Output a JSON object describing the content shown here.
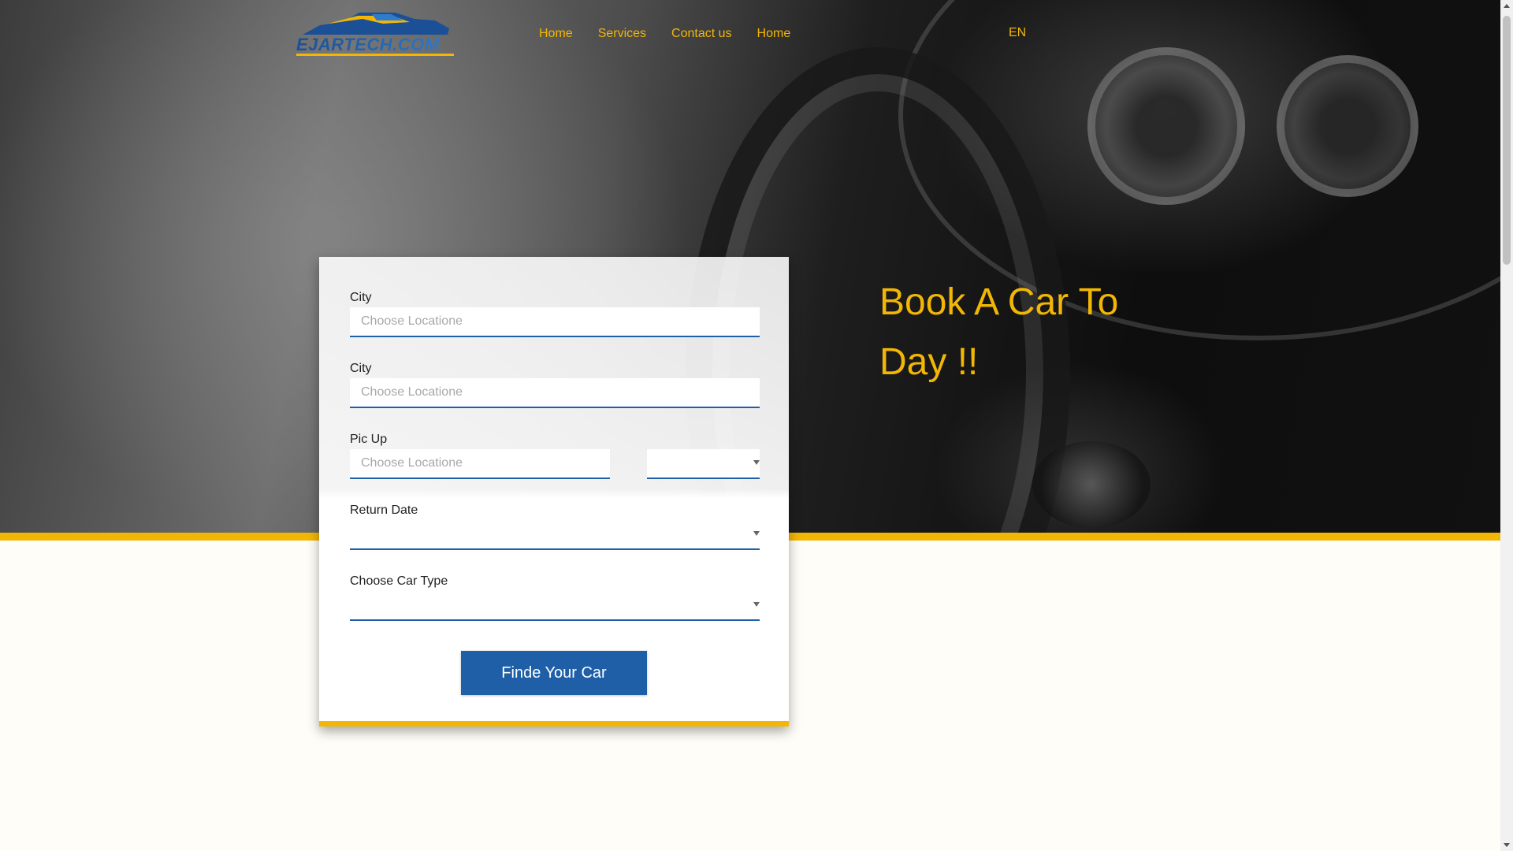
{
  "header": {
    "logo_text": "EJARTECH.COM",
    "nav": [
      {
        "label": "Home"
      },
      {
        "label": "Services"
      },
      {
        "label": "Contact us"
      },
      {
        "label": "Home"
      }
    ],
    "language": "EN"
  },
  "hero": {
    "headline_line1": "Book A Car To",
    "headline_line2": "Day !!"
  },
  "form": {
    "city1": {
      "label": "City",
      "placeholder": "Choose Locatione",
      "value": ""
    },
    "city2": {
      "label": "City",
      "placeholder": "Choose Locatione",
      "value": ""
    },
    "pickup": {
      "label": "Pic Up",
      "placeholder": "Choose Locatione",
      "value": "",
      "time_value": ""
    },
    "return_date": {
      "label": "Return Date",
      "value": ""
    },
    "car_type": {
      "label": "Choose Car Type",
      "value": ""
    },
    "submit_label": "Finde Your Car"
  },
  "colors": {
    "accent": "#f2b705",
    "primary": "#1f5fa8",
    "background": "#fffdf7"
  }
}
